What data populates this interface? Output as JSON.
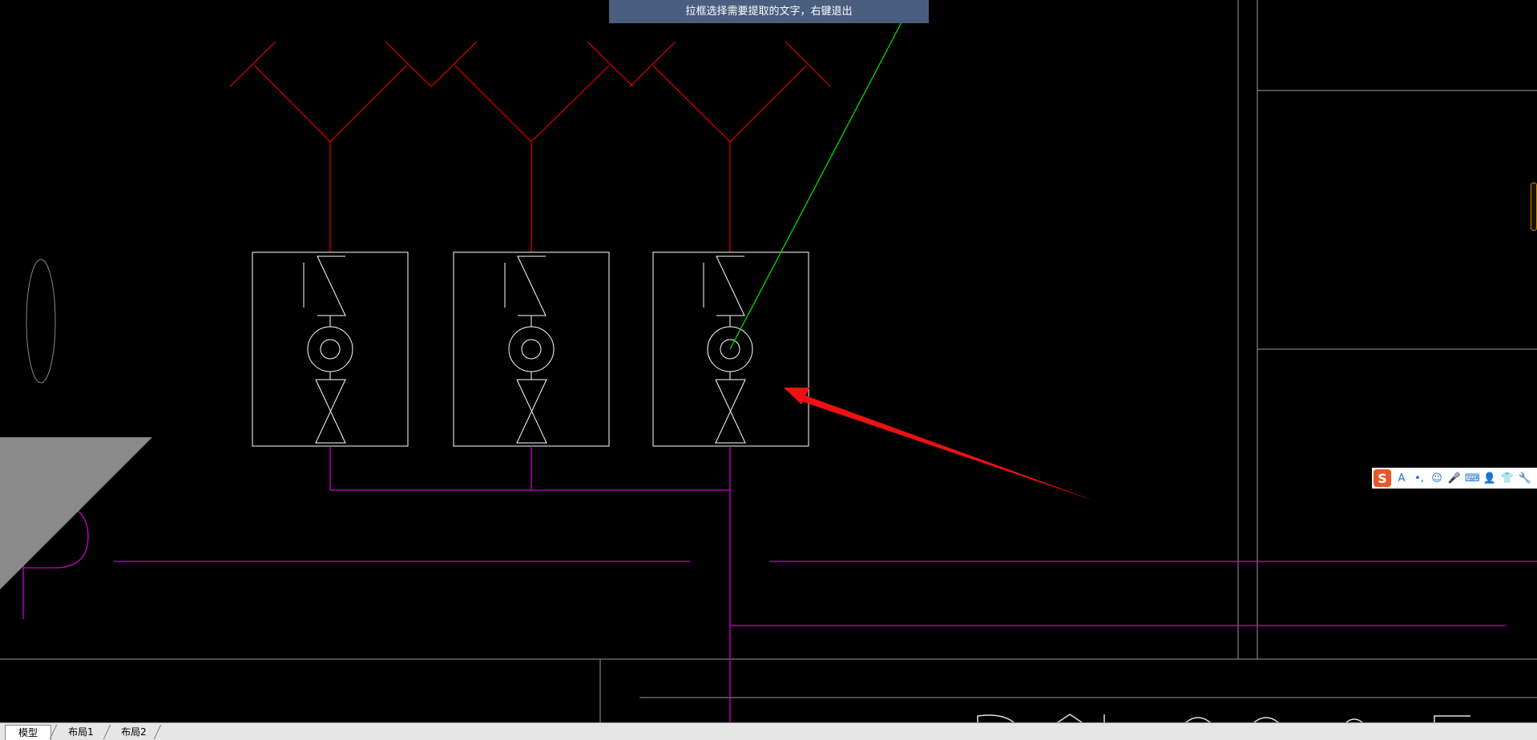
{
  "hint": {
    "text": "拉框选择需要提取的文字，右键退出"
  },
  "tabs": [
    {
      "label": "模型",
      "active": true
    },
    {
      "label": "布局1",
      "active": false
    },
    {
      "label": "布局2",
      "active": false
    }
  ],
  "ime_toolbar": {
    "logo": "S",
    "tools": [
      "A",
      "•,",
      "emoji-icon",
      "microphone-icon",
      "keyboard-icon",
      "user-icon",
      "shirt-icon",
      "wrench-icon"
    ]
  },
  "colors": {
    "background": "#000000",
    "pipe_red": "#cc0000",
    "pipe_magenta": "#cc00cc",
    "equipment_white": "#ffffff",
    "leader_green": "#00ff00",
    "annotation_arrow": "#ee1111",
    "hint_bar": "#4a5e80",
    "gray_fill": "#8a8a8a"
  }
}
